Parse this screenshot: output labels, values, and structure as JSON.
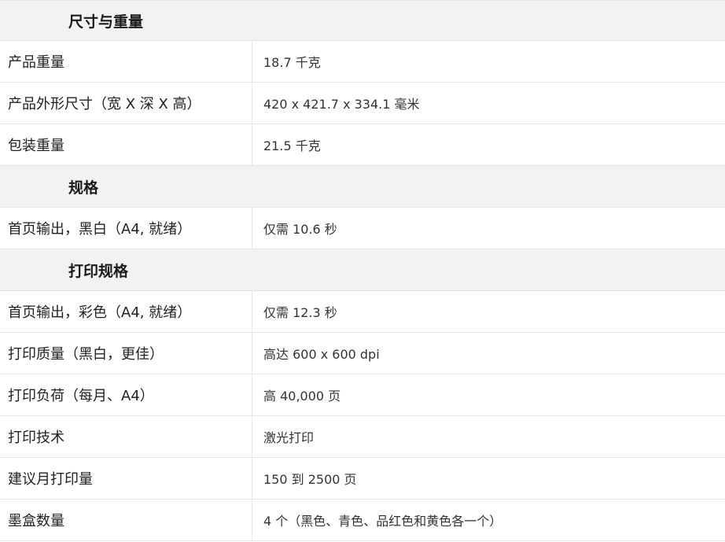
{
  "sections": [
    {
      "title": "尺寸与重量",
      "rows": [
        {
          "label": "产品重量",
          "value": "18.7 千克"
        },
        {
          "label": "产品外形尺寸（宽 X 深 X 高）",
          "value": "420 x 421.7 x 334.1 毫米"
        },
        {
          "label": "包装重量",
          "value": "21.5 千克"
        }
      ]
    },
    {
      "title": "规格",
      "rows": [
        {
          "label": "首页输出，黑白（A4, 就绪）",
          "value": "仅需 10.6 秒"
        }
      ]
    },
    {
      "title": "打印规格",
      "rows": [
        {
          "label": "首页输出，彩色（A4, 就绪）",
          "value": "仅需 12.3 秒"
        },
        {
          "label": "打印质量（黑白，更佳）",
          "value": "高达 600 x 600 dpi"
        },
        {
          "label": "打印负荷（每月、A4）",
          "value": "高 40,000 页"
        },
        {
          "label": "打印技术",
          "value": "激光打印"
        },
        {
          "label": "建议月打印量",
          "value": "150 到 2500 页"
        },
        {
          "label": "墨盒数量",
          "value": "4 个（黑色、青色、品红色和黄色各一个）"
        }
      ]
    }
  ]
}
